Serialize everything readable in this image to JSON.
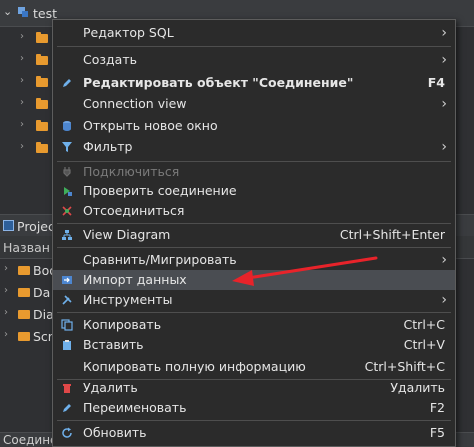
{
  "tree": {
    "connection_label": "test",
    "rows": 6
  },
  "projects": {
    "panel_title": "Projec",
    "column_title": "Назван",
    "items": [
      {
        "label": "Boo"
      },
      {
        "label": "Da"
      },
      {
        "label": "Dia"
      },
      {
        "label": "Scr"
      }
    ]
  },
  "bottom_bar": {
    "label": "Соединения test"
  },
  "menu": {
    "items": [
      {
        "id": "sql-editor",
        "label": "Редактор SQL",
        "shortcut": "",
        "submenu": true,
        "icon": "none-icon"
      },
      {
        "id": "create",
        "label": "Создать",
        "shortcut": "",
        "submenu": true,
        "icon": "none-icon"
      },
      {
        "id": "edit-connection",
        "label": "Редактировать объект \"Соединение\"",
        "shortcut": "F4",
        "submenu": false,
        "icon": "pencil-icon",
        "bold": true
      },
      {
        "id": "connection-view",
        "label": "Connection view",
        "shortcut": "",
        "submenu": true,
        "icon": "none-icon"
      },
      {
        "id": "open-new-window",
        "label": "Открыть новое окно",
        "shortcut": "",
        "submenu": false,
        "icon": "database-icon"
      },
      {
        "id": "filter",
        "label": "Фильтр",
        "shortcut": "",
        "submenu": true,
        "icon": "filter-icon"
      },
      {
        "id": "connect",
        "label": "Подключиться",
        "shortcut": "",
        "submenu": false,
        "icon": "plug-icon",
        "disabled": true
      },
      {
        "id": "test-connection",
        "label": "Проверить соединение",
        "shortcut": "",
        "submenu": false,
        "icon": "plug-check-icon"
      },
      {
        "id": "disconnect",
        "label": "Отсоединиться",
        "shortcut": "",
        "submenu": false,
        "icon": "disconnect-icon"
      },
      {
        "id": "view-diagram",
        "label": "View Diagram",
        "shortcut": "Ctrl+Shift+Enter",
        "submenu": false,
        "icon": "diagram-icon"
      },
      {
        "id": "compare-migrate",
        "label": "Сравнить/Мигрировать",
        "shortcut": "",
        "submenu": true,
        "icon": "none-icon"
      },
      {
        "id": "import-data",
        "label": "Импорт данных",
        "shortcut": "",
        "submenu": false,
        "icon": "import-icon",
        "highlighted": true
      },
      {
        "id": "tools",
        "label": "Инструменты",
        "shortcut": "",
        "submenu": true,
        "icon": "tools-icon"
      },
      {
        "id": "copy",
        "label": "Копировать",
        "shortcut": "Ctrl+C",
        "submenu": false,
        "icon": "copy-icon"
      },
      {
        "id": "paste",
        "label": "Вставить",
        "shortcut": "Ctrl+V",
        "submenu": false,
        "icon": "paste-icon"
      },
      {
        "id": "copy-full-info",
        "label": "Копировать полную информацию",
        "shortcut": "Ctrl+Shift+C",
        "submenu": false,
        "icon": "none-icon"
      },
      {
        "id": "delete",
        "label": "Удалить",
        "shortcut": "Удалить",
        "submenu": false,
        "icon": "trash-icon"
      },
      {
        "id": "rename",
        "label": "Переименовать",
        "shortcut": "F2",
        "submenu": false,
        "icon": "rename-icon"
      },
      {
        "id": "refresh",
        "label": "Обновить",
        "shortcut": "F5",
        "submenu": false,
        "icon": "refresh-icon"
      }
    ]
  },
  "colors": {
    "menu_bg": "#2b2b2b",
    "highlight": "#4a4d52",
    "annotation_arrow": "#e8232a",
    "folder": "#e89a2f"
  }
}
